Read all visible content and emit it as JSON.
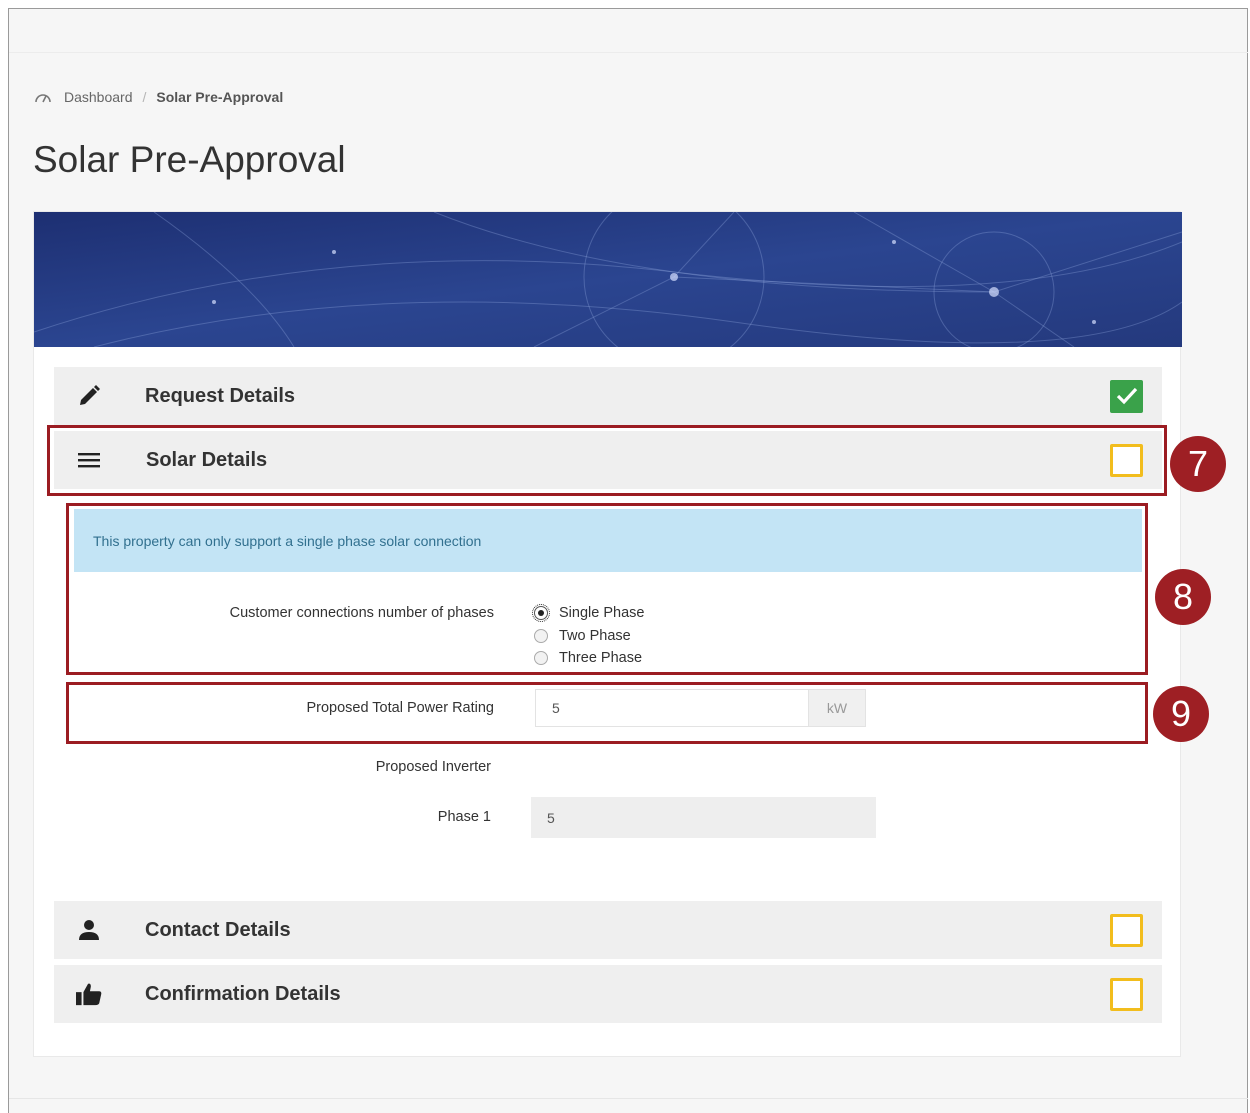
{
  "breadcrumb": {
    "home": "Dashboard",
    "separator": "/",
    "current": "Solar Pre-Approval"
  },
  "page_title": "Solar Pre-Approval",
  "steps": [
    {
      "label": "Request Details",
      "icon": "pencil-icon",
      "status": "complete"
    },
    {
      "label": "Solar Details",
      "icon": "menu-icon",
      "status": "incomplete"
    },
    {
      "label": "Contact Details",
      "icon": "user-icon",
      "status": "incomplete"
    },
    {
      "label": "Confirmation Details",
      "icon": "thumbs-up-icon",
      "status": "incomplete"
    }
  ],
  "solar": {
    "info": "This property can only support a single phase solar connection",
    "phases_label": "Customer connections number of phases",
    "phase_options": [
      "Single Phase",
      "Two Phase",
      "Three Phase"
    ],
    "selected_phase": "Single Phase",
    "power_label": "Proposed Total Power Rating",
    "power_value": "5",
    "power_unit": "kW",
    "inverter_label": "Proposed Inverter",
    "phase1_label": "Phase 1",
    "phase1_value": "5"
  },
  "annotations": [
    "7",
    "8",
    "9"
  ],
  "colors": {
    "highlight": "#9b1c22",
    "complete": "#3aa24a",
    "incomplete": "#f2bd1d",
    "info_bg": "#c3e4f5",
    "info_text": "#31708f"
  }
}
